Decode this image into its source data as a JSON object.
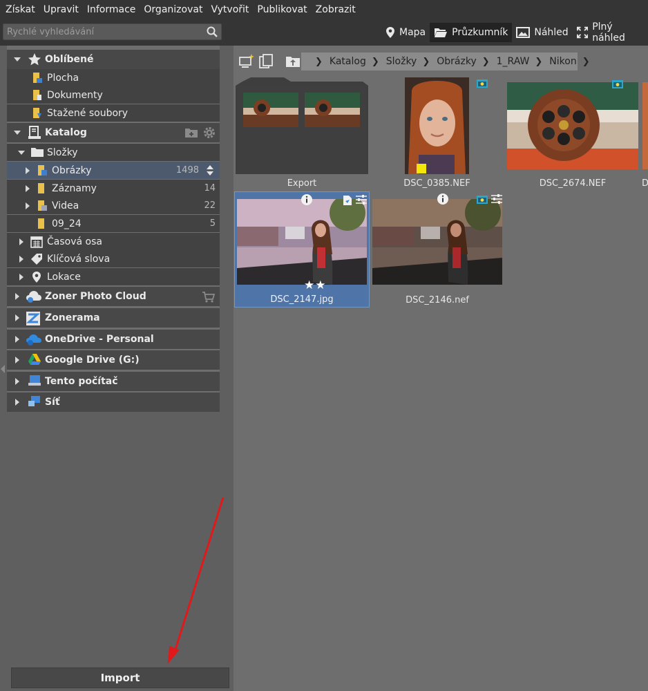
{
  "menu": [
    "Získat",
    "Upravit",
    "Informace",
    "Organizovat",
    "Vytvořit",
    "Publikovat",
    "Zobrazit"
  ],
  "search": {
    "placeholder": "Rychlé vyhledávání"
  },
  "modes": {
    "map": "Mapa",
    "browser": "Průzkumník",
    "preview": "Náhled",
    "full_preview": "Plný náhled"
  },
  "sidebar": {
    "favorites": {
      "title": "Oblíbené",
      "items": [
        "Plocha",
        "Dokumenty",
        "Stažené soubory"
      ]
    },
    "catalog": {
      "title": "Katalog",
      "folders": "Složky",
      "folder_items": [
        {
          "label": "Obrázky",
          "count": "1498"
        },
        {
          "label": "Záznamy",
          "count": "14"
        },
        {
          "label": "Videa",
          "count": "22"
        },
        {
          "label": "09_24",
          "count": "5"
        }
      ],
      "timeline": "Časová osa",
      "keywords": "Klíčová slova",
      "locations": "Lokace"
    },
    "sources": [
      "Zoner Photo Cloud",
      "Zonerama",
      "OneDrive - Personal",
      "Google Drive (G:)",
      "Tento počítač",
      "Síť"
    ]
  },
  "import_label": "Import",
  "breadcrumb": [
    "Katalog",
    "Složky",
    "Obrázky",
    "1_RAW",
    "Nikon"
  ],
  "thumbnails": {
    "export": "Export",
    "dsc0385": "DSC_0385.NEF",
    "dsc2674": "DSC_2674.NEF",
    "partial": "D",
    "dsc2147": "DSC_2147.jpg",
    "dsc2146": "DSC_2146.nef",
    "dsc2147_rating": 2
  },
  "colors": {
    "accent": "#4f74a8",
    "arrow": "#e01a1a",
    "label_yellow": "#f4e60a"
  }
}
